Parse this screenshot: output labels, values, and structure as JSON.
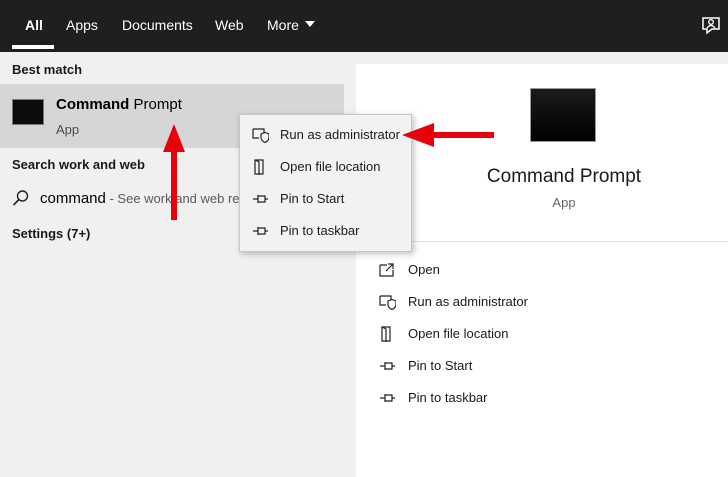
{
  "tabs": [
    {
      "label": "All",
      "active": true
    },
    {
      "label": "Apps"
    },
    {
      "label": "Documents"
    },
    {
      "label": "Web"
    },
    {
      "label": "More"
    }
  ],
  "left": {
    "best_match_label": "Best match",
    "best_title_bold": "Command",
    "best_title_rest": " Prompt",
    "best_sub": "App",
    "search_work_web_label": "Search work and web",
    "search_query": "command",
    "search_hint": " - See work and web results",
    "settings_label": "Settings (7+)"
  },
  "context_menu": {
    "items": [
      "Run as administrator",
      "Open file location",
      "Pin to Start",
      "Pin to taskbar"
    ]
  },
  "right": {
    "title": "Command Prompt",
    "sub": "App",
    "actions": [
      "Open",
      "Run as administrator",
      "Open file location",
      "Pin to Start",
      "Pin to taskbar"
    ]
  },
  "colors": {
    "topbar": "#1f1f1f",
    "highlight": "#d6d6d6",
    "arrow": "#e8000b"
  }
}
